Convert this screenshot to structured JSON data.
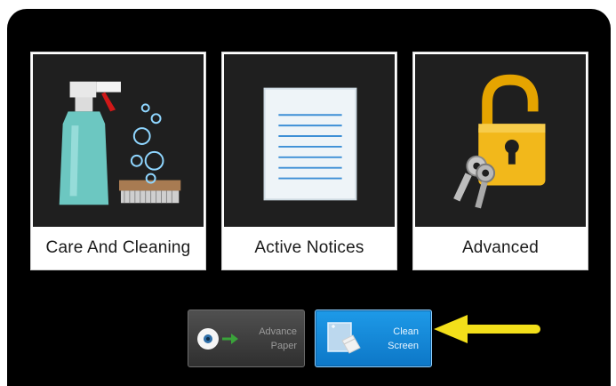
{
  "tiles": [
    {
      "label": "Care And Cleaning",
      "icon": "spray-bottle-icon"
    },
    {
      "label": "Active Notices",
      "icon": "document-icon"
    },
    {
      "label": "Advanced",
      "icon": "padlock-keys-icon"
    }
  ],
  "buttons": {
    "advance_paper": {
      "line1": "Advance",
      "line2": "Paper",
      "icon": "paper-roll-icon"
    },
    "clean_screen": {
      "line1": "Clean",
      "line2": "Screen",
      "icon": "screen-wipe-icon"
    }
  },
  "colors": {
    "screen_bg": "#000000",
    "tile_art_bg": "#1f1f1f",
    "clean_button": "#1a8fe0",
    "arrow": "#f3df1a"
  }
}
